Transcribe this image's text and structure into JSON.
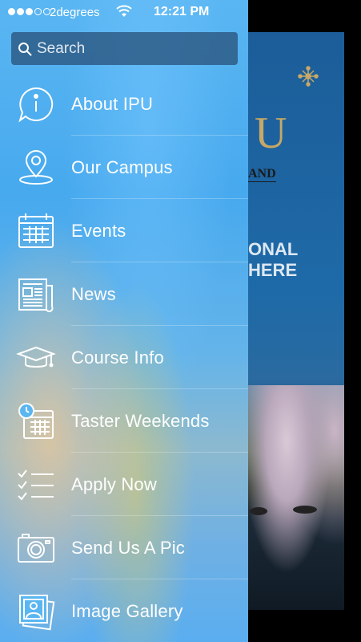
{
  "status_bar": {
    "carrier": "2degrees",
    "time": "12:21 PM"
  },
  "search": {
    "placeholder": "Search"
  },
  "menu": {
    "items": [
      {
        "label": "About IPU",
        "icon": "info-bubble-icon"
      },
      {
        "label": "Our Campus",
        "icon": "map-pin-icon"
      },
      {
        "label": "Events",
        "icon": "calendar-icon"
      },
      {
        "label": "News",
        "icon": "newspaper-icon"
      },
      {
        "label": "Course Info",
        "icon": "graduation-cap-icon"
      },
      {
        "label": "Taster Weekends",
        "icon": "clock-calendar-icon"
      },
      {
        "label": "Apply Now",
        "icon": "checklist-icon"
      },
      {
        "label": "Send Us A Pic",
        "icon": "camera-icon"
      },
      {
        "label": "Image Gallery",
        "icon": "photo-gallery-icon"
      }
    ]
  },
  "background_app": {
    "logo_letter": "U",
    "logo_subtext": "AND",
    "headline_line1": "ONAL",
    "headline_line2": "HERE"
  },
  "colors": {
    "menu_gradient_top": "#5ab6f2",
    "search_bg": "#285078",
    "logo_gold": "#c7a866",
    "text": "#ffffff"
  }
}
